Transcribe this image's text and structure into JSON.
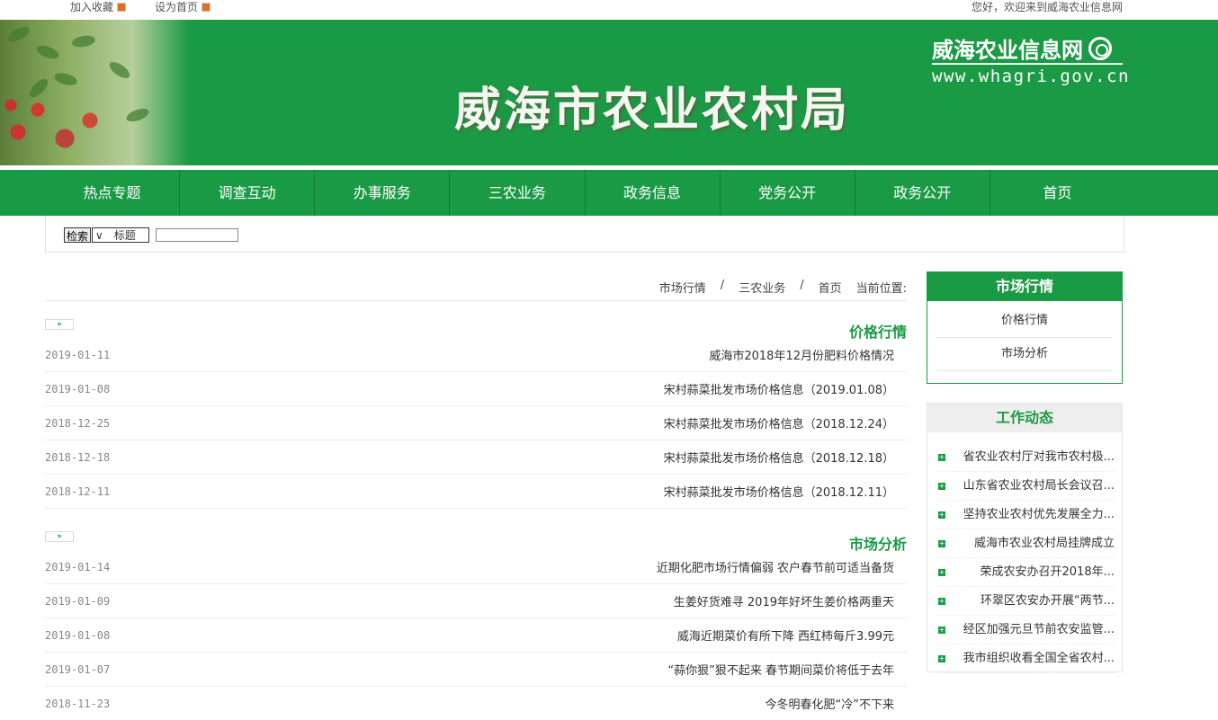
{
  "topbar": {
    "bookmark": "加入收藏",
    "homepage": "设为首页",
    "welcome": "您好，欢迎来到威海农业信息网"
  },
  "banner": {
    "title": "威海市农业农村局",
    "site_name": "威海农业信息网",
    "url": "www.whagri.gov.cn"
  },
  "nav": [
    "热点专题",
    "调查互动",
    "办事服务",
    "三农业务",
    "政务信息",
    "党务公开",
    "政务公开",
    "首页"
  ],
  "search": {
    "button": "检索",
    "select_value": "标题"
  },
  "breadcrumb": {
    "prefix": "当前位置:",
    "items": [
      "首页",
      "三农业务",
      "市场行情"
    ],
    "sep": "/"
  },
  "sections": [
    {
      "title": "价格行情",
      "more": "»",
      "rows": [
        {
          "title": "威海市2018年12月份肥料价格情况",
          "date": "2019-01-11"
        },
        {
          "title": "宋村蒜菜批发市场价格信息（2019.01.08）",
          "date": "2019-01-08"
        },
        {
          "title": "宋村蒜菜批发市场价格信息（2018.12.24）",
          "date": "2018-12-25"
        },
        {
          "title": "宋村蒜菜批发市场价格信息（2018.12.18）",
          "date": "2018-12-18"
        },
        {
          "title": "宋村蒜菜批发市场价格信息（2018.12.11）",
          "date": "2018-12-11"
        }
      ]
    },
    {
      "title": "市场分析",
      "more": "»",
      "rows": [
        {
          "title": "近期化肥市场行情偏弱 农户春节前可适当备货",
          "date": "2019-01-14"
        },
        {
          "title": "生姜好货难寻 2019年好坏生姜价格两重天",
          "date": "2019-01-09"
        },
        {
          "title": "威海近期菜价有所下降 西红柿每斤3.99元",
          "date": "2019-01-08"
        },
        {
          "title": "“蒜你狠”狠不起来 春节期间菜价将低于去年",
          "date": "2019-01-07"
        },
        {
          "title": "今冬明春化肥“冷”不下来",
          "date": "2018-11-23"
        }
      ]
    }
  ],
  "sidebar": {
    "market_title": "市场行情",
    "market_items": [
      "价格行情",
      "市场分析"
    ],
    "news_title": "工作动态",
    "news_items": [
      "省农业农村厅对我市农村极...",
      "山东省农业农村局长会议召...",
      "坚持农业农村优先发展全力...",
      "威海市农业农村局挂牌成立",
      "荣成农安办召开2018年...",
      "环翠区农安办开展“两节...",
      "经区加强元旦节前农安监管...",
      "我市组织收看全国全省农村..."
    ]
  },
  "colors": {
    "brand_green": "#1b9a45",
    "date_gray": "#888888"
  }
}
